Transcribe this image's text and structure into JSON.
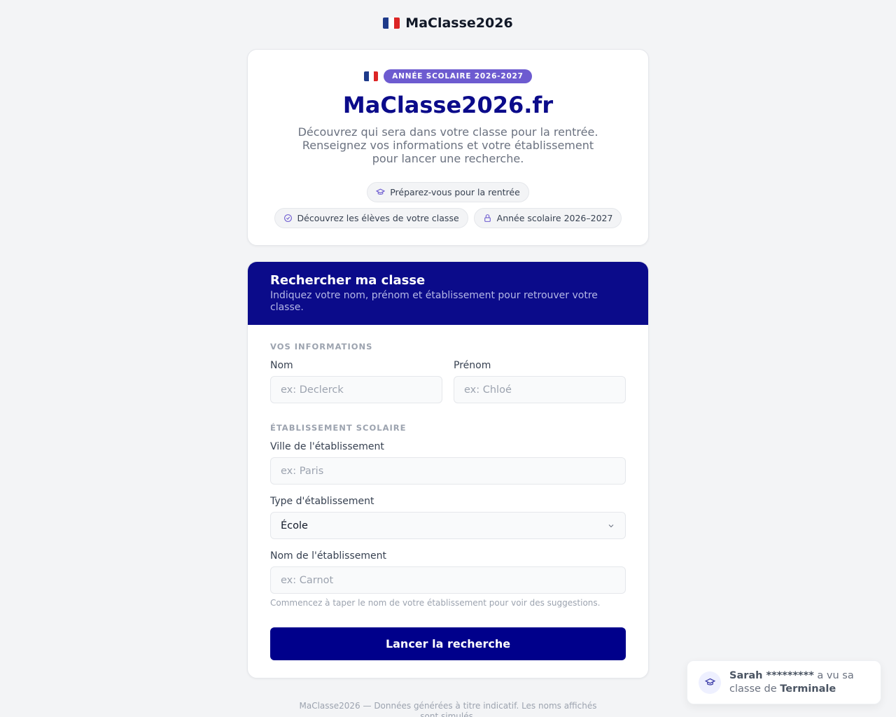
{
  "topbar": {
    "brand": "MaClasse2026"
  },
  "hero": {
    "badge": "ANNÉE SCOLAIRE 2026-2027",
    "title": "MaClasse2026.fr",
    "description": "Découvrez qui sera dans votre classe pour la rentrée. Renseignez vos informations et votre établissement pour lancer une recherche.",
    "pills": [
      {
        "icon": "graduation-cap-icon",
        "label": "Préparez-vous pour la rentrée"
      },
      {
        "icon": "check-circle-icon",
        "label": "Découvrez les élèves de votre classe"
      },
      {
        "icon": "lock-icon",
        "label": "Année scolaire 2026–2027"
      }
    ]
  },
  "form": {
    "title": "Rechercher ma classe",
    "subtitle": "Indiquez votre nom, prénom et établissement pour retrouver votre classe.",
    "section_info": "VOS INFORMATIONS",
    "nom_label": "Nom",
    "nom_placeholder": "ex: Declerck",
    "prenom_label": "Prénom",
    "prenom_placeholder": "ex: Chloé",
    "section_school": "ÉTABLISSEMENT SCOLAIRE",
    "ville_label": "Ville de l'établissement",
    "ville_placeholder": "ex: Paris",
    "type_label": "Type d'établissement",
    "type_value": "École",
    "etab_label": "Nom de l'établissement",
    "etab_placeholder": "ex: Carnot",
    "hint": "Commencez à taper le nom de votre établissement pour voir des suggestions.",
    "submit": "Lancer la recherche"
  },
  "footer": {
    "text": "MaClasse2026 — Données générées à titre indicatif. Les noms affichés sont simulés."
  },
  "toast": {
    "name": "Sarah *********",
    "middle": " a vu sa classe de ",
    "classe": "Terminale"
  },
  "colors": {
    "primary": "#0b0b8a",
    "badge": "#6d5bd0"
  }
}
